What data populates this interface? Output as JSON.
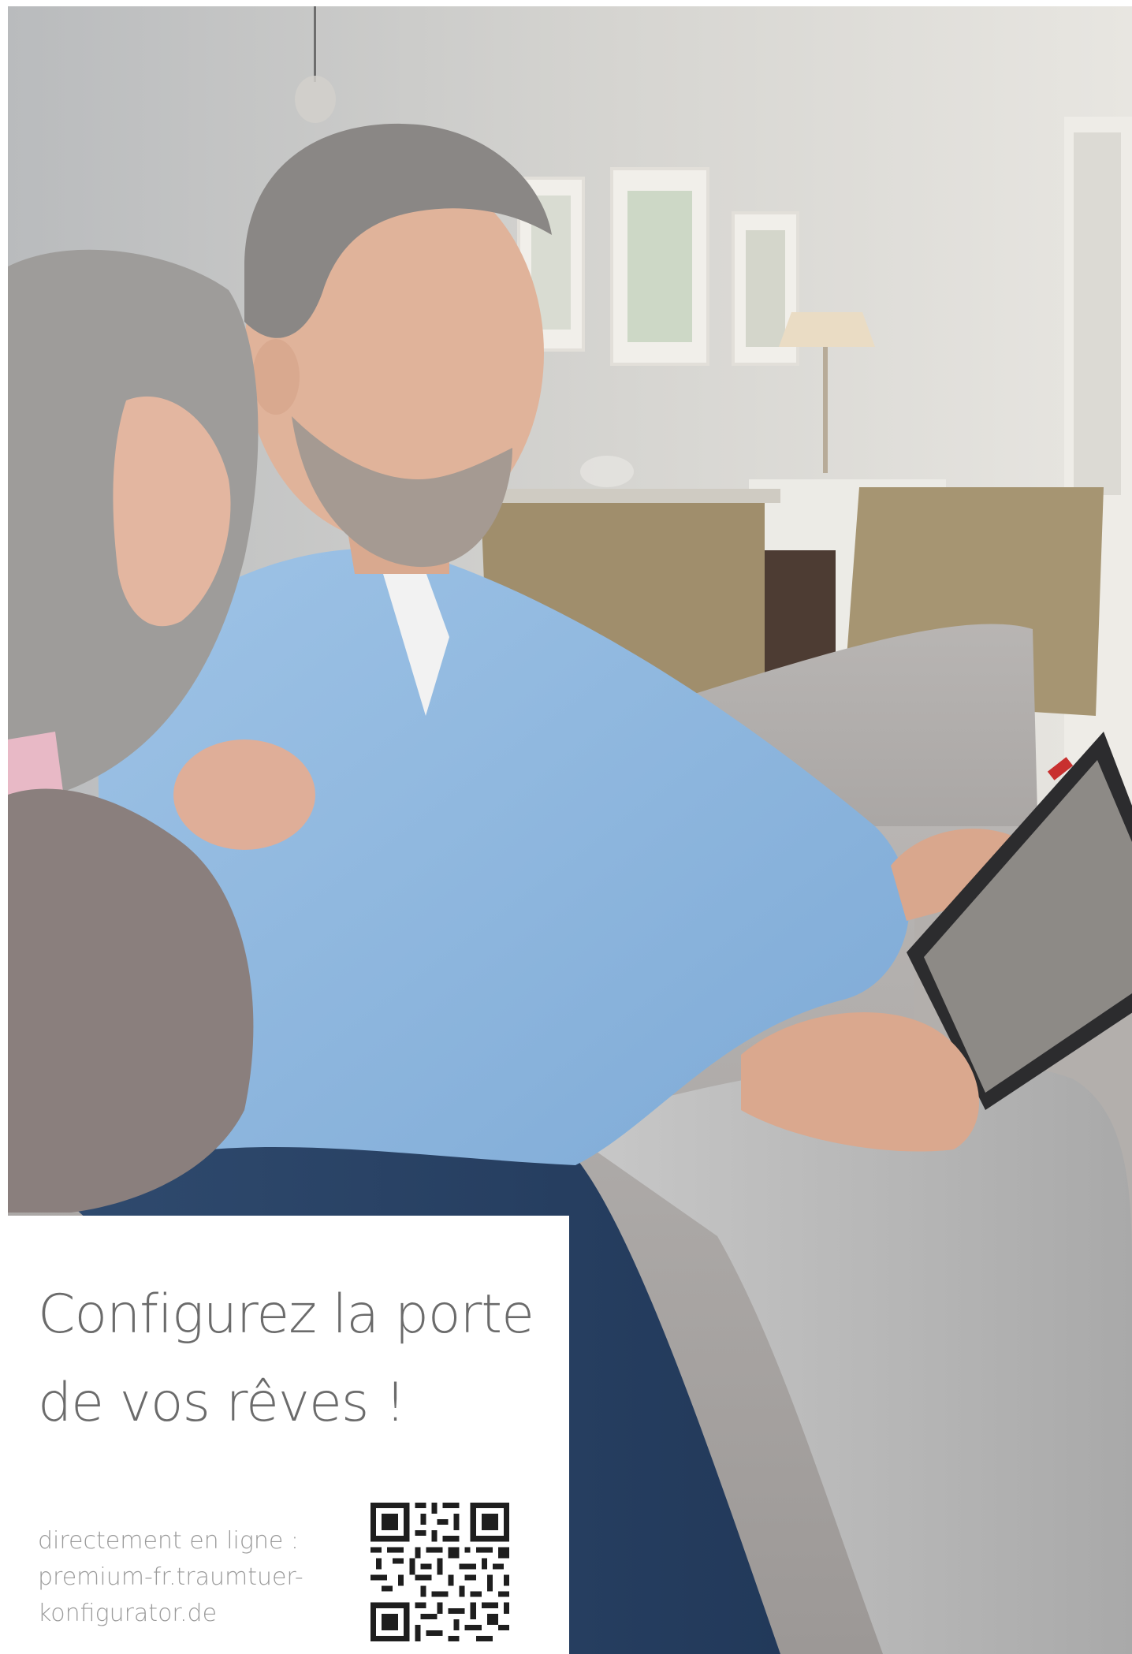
{
  "photo": {
    "description_icon": "photo-couple-with-tablet-icon"
  },
  "headline": {
    "line1": "Configurez la porte",
    "line2": "de vos rêves !"
  },
  "cta": {
    "line1": "directement en ligne :",
    "line2": "premium-fr.traumtuer-",
    "line3": "konfigurator.de"
  },
  "qr": {
    "icon": "qr-code-icon"
  },
  "colors": {
    "headline": "#6b6b6b",
    "cta": "#9a9a9a",
    "background": "#ffffff"
  }
}
